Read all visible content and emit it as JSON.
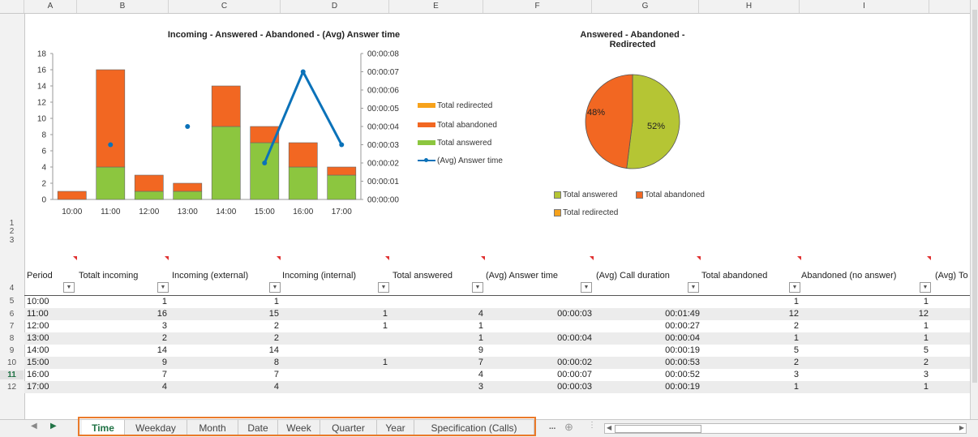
{
  "columns": [
    "A",
    "B",
    "C",
    "D",
    "E",
    "F",
    "G",
    "H",
    "I"
  ],
  "rows": [
    "1",
    "2",
    "3",
    "4",
    "5",
    "6",
    "7",
    "8",
    "9",
    "10",
    "11",
    "12"
  ],
  "active_row": "11",
  "bar_chart": {
    "title": "Incoming - Answered - Abandoned - (Avg) Answer time",
    "left_ticks": [
      "18",
      "16",
      "14",
      "12",
      "10",
      "8",
      "6",
      "4",
      "2",
      "0"
    ],
    "right_ticks": [
      "00:00:08",
      "00:00:07",
      "00:00:06",
      "00:00:05",
      "00:00:04",
      "00:00:03",
      "00:00:02",
      "00:00:01",
      "00:00:00"
    ],
    "categories": [
      "10:00",
      "11:00",
      "12:00",
      "13:00",
      "14:00",
      "15:00",
      "16:00",
      "17:00"
    ],
    "legend": [
      "Total redirected",
      "Total abandoned",
      "Total answered",
      "(Avg) Answer time"
    ],
    "colors": {
      "redirected": "#f7a21b",
      "abandoned": "#f26722",
      "answered": "#8cc63f",
      "answer_time": "#0b72b9"
    }
  },
  "pie_chart": {
    "title_line1": "Answered - Abandoned -",
    "title_line2": "Redirected",
    "labels": [
      "48%",
      "52%"
    ],
    "legend": [
      "Total answered",
      "Total abandoned",
      "Total redirected"
    ],
    "colors": {
      "answered": "#b5c534",
      "abandoned": "#f26722",
      "redirected": "#f7a21b"
    }
  },
  "chart_data": [
    {
      "type": "bar",
      "title": "Incoming - Answered - Abandoned - (Avg) Answer time",
      "categories": [
        "10:00",
        "11:00",
        "12:00",
        "13:00",
        "14:00",
        "15:00",
        "16:00",
        "17:00"
      ],
      "ylim": [
        0,
        18
      ],
      "y2lim": [
        "00:00:00",
        "00:00:08"
      ],
      "series": [
        {
          "name": "Total answered",
          "values": [
            0,
            4,
            1,
            1,
            9,
            7,
            4,
            3
          ]
        },
        {
          "name": "Total abandoned",
          "values": [
            1,
            12,
            2,
            1,
            5,
            2,
            3,
            1
          ]
        },
        {
          "name": "Total redirected",
          "values": [
            0,
            0,
            0,
            0,
            0,
            0,
            0,
            0
          ]
        },
        {
          "name": "(Avg) Answer time",
          "values": [
            null,
            "00:00:03",
            null,
            "00:00:04",
            null,
            "00:00:02",
            "00:00:07",
            "00:00:03"
          ],
          "axis": "right"
        }
      ]
    },
    {
      "type": "pie",
      "title": "Answered - Abandoned - Redirected",
      "categories": [
        "Total answered",
        "Total abandoned",
        "Total redirected"
      ],
      "values": [
        52,
        48,
        0
      ]
    }
  ],
  "table": {
    "headers": [
      "Period",
      "Totalt incoming",
      "Incoming (external)",
      "Incoming (internal)",
      "Total answered",
      "(Avg) Answer time",
      "(Avg) Call duration",
      "Total abandoned",
      "Abandoned (no answer)",
      "(Avg) To"
    ],
    "rows": [
      [
        "10:00",
        "1",
        "1",
        "",
        "",
        "",
        "",
        "1",
        "1"
      ],
      [
        "11:00",
        "16",
        "15",
        "1",
        "4",
        "00:00:03",
        "00:01:49",
        "12",
        "12"
      ],
      [
        "12:00",
        "3",
        "2",
        "1",
        "1",
        "",
        "00:00:27",
        "2",
        "1"
      ],
      [
        "13:00",
        "2",
        "2",
        "",
        "1",
        "00:00:04",
        "00:00:04",
        "1",
        "1"
      ],
      [
        "14:00",
        "14",
        "14",
        "",
        "9",
        "",
        "00:00:19",
        "5",
        "5"
      ],
      [
        "15:00",
        "9",
        "8",
        "1",
        "7",
        "00:00:02",
        "00:00:53",
        "2",
        "2"
      ],
      [
        "16:00",
        "7",
        "7",
        "",
        "4",
        "00:00:07",
        "00:00:52",
        "3",
        "3"
      ],
      [
        "17:00",
        "4",
        "4",
        "",
        "3",
        "00:00:03",
        "00:00:19",
        "1",
        "1"
      ]
    ]
  },
  "sheet_tabs": [
    "Time",
    "Weekday",
    "Month",
    "Date",
    "Week",
    "Quarter",
    "Year",
    "Specification (Calls)"
  ],
  "active_tab": "Time",
  "tab_more": "...",
  "accent_color": "#217346",
  "highlight_color": "#ea7a2a"
}
